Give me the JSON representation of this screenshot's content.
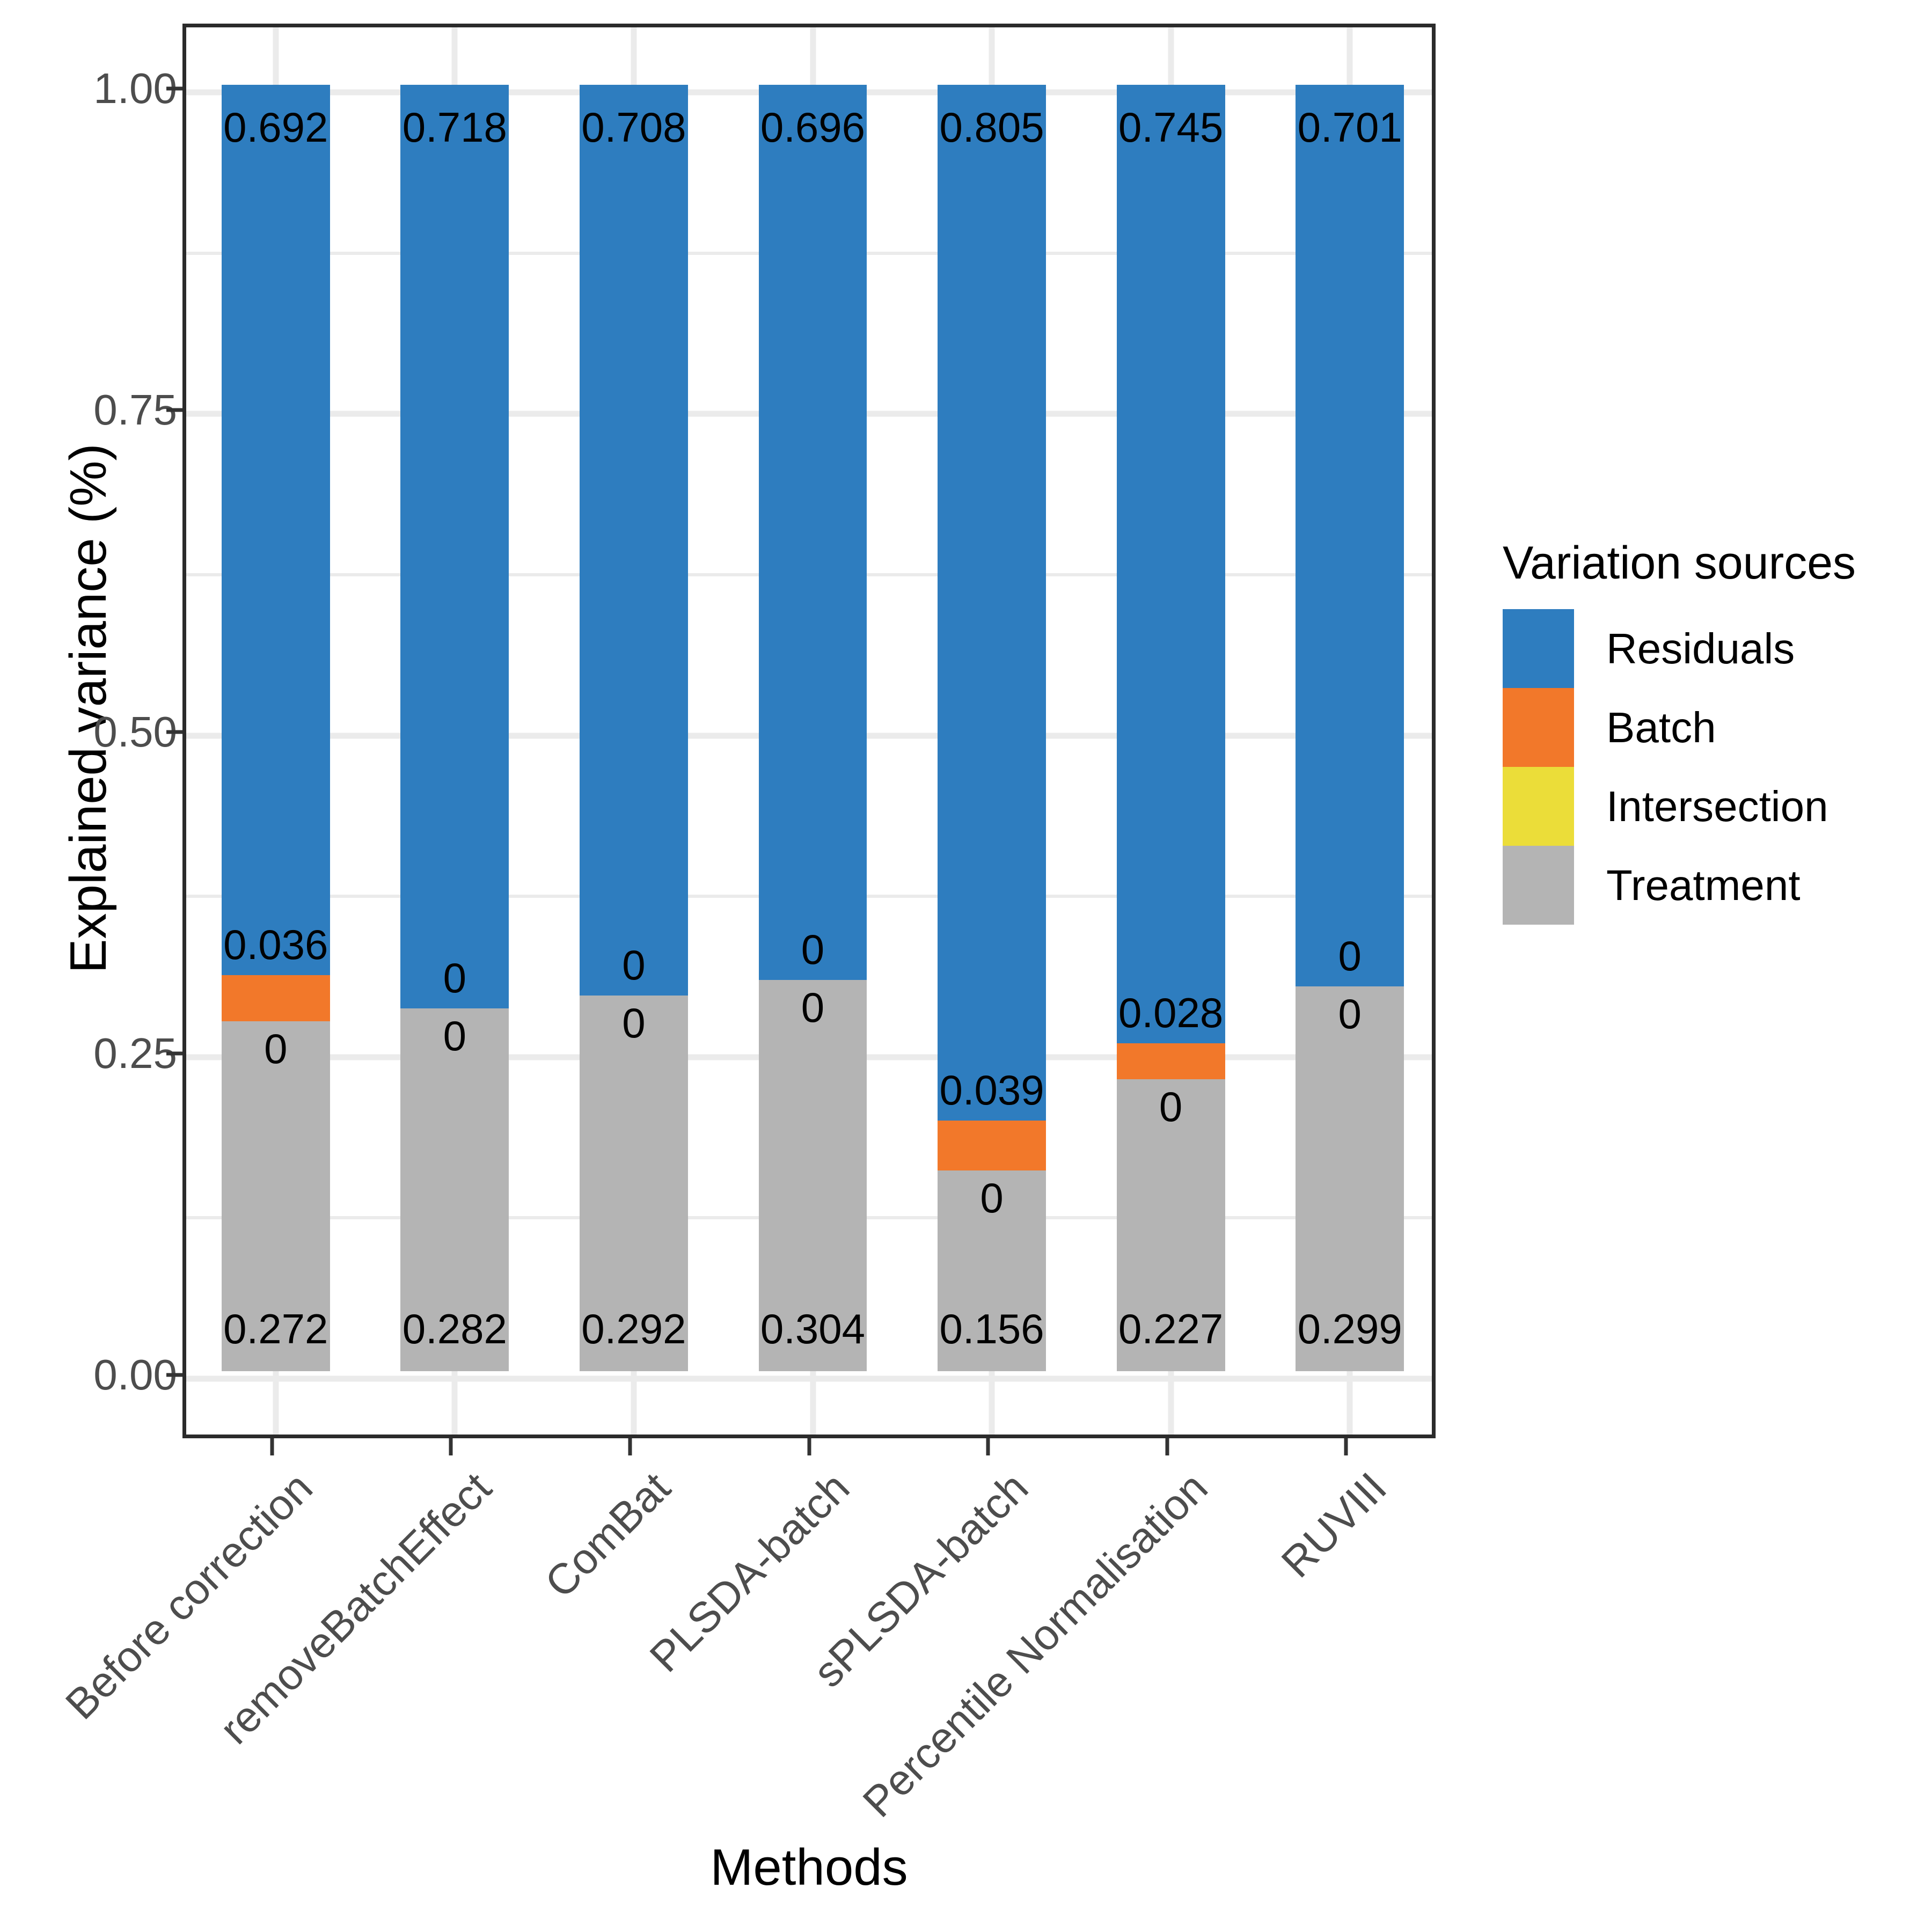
{
  "chart_data": {
    "type": "bar",
    "subtype": "stacked-bar-100",
    "title": "",
    "xlabel": "Methods",
    "ylabel": "Explained variance (%)",
    "ylim": [
      0,
      1.0
    ],
    "ytick_labels": [
      "0.00",
      "0.25",
      "0.50",
      "0.75",
      "1.00"
    ],
    "ytick_values": [
      0,
      0.25,
      0.5,
      0.75,
      1.0
    ],
    "grid": true,
    "legend_position": "right",
    "categories": [
      "Before correction",
      "removeBatchEffect",
      "ComBat",
      "PLSDA-batch",
      "sPLSDA-batch",
      "Percentile Normalisation",
      "RUVIII"
    ],
    "series": [
      {
        "name": "Treatment",
        "color": "#b4b4b4",
        "values": [
          0.272,
          0.282,
          0.292,
          0.304,
          0.156,
          0.227,
          0.299
        ],
        "labels": [
          "0.272",
          "0.282",
          "0.292",
          "0.304",
          "0.156",
          "0.227",
          "0.299"
        ]
      },
      {
        "name": "Intersection",
        "color": "#ebdd39",
        "values": [
          0,
          0,
          0,
          0,
          0,
          0,
          0
        ],
        "labels": [
          "0",
          "0",
          "0",
          "0",
          "0",
          "0",
          "0"
        ]
      },
      {
        "name": "Batch",
        "color": "#f2782a",
        "values": [
          0.036,
          0,
          0,
          0,
          0.039,
          0.028,
          0
        ],
        "labels": [
          "0.036",
          "0",
          "0",
          "0",
          "0.039",
          "0.028",
          "0"
        ]
      },
      {
        "name": "Residuals",
        "color": "#2e7dbf",
        "values": [
          0.692,
          0.718,
          0.708,
          0.696,
          0.805,
          0.745,
          0.701
        ],
        "labels": [
          "0.692",
          "0.718",
          "0.708",
          "0.696",
          "0.805",
          "0.745",
          "0.701"
        ]
      }
    ]
  },
  "axes": {
    "y_title": "Explained variance (%)",
    "x_title": "Methods"
  },
  "legend": {
    "title": "Variation sources",
    "items": [
      {
        "label": "Residuals",
        "color": "#2e7dbf"
      },
      {
        "label": "Batch",
        "color": "#f2782a"
      },
      {
        "label": "Intersection",
        "color": "#ebdd39"
      },
      {
        "label": "Treatment",
        "color": "#b4b4b4"
      }
    ]
  }
}
